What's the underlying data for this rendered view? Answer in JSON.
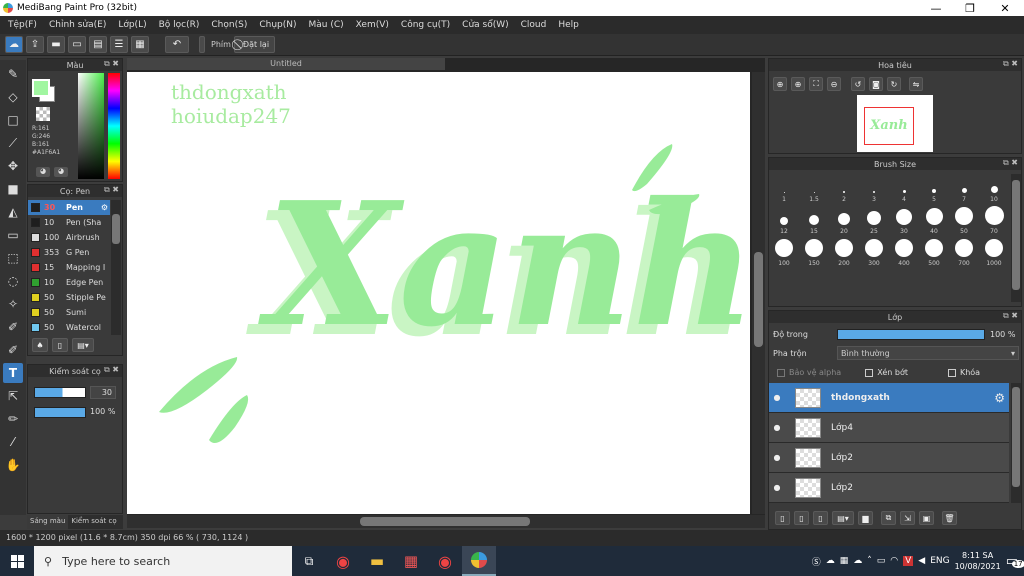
{
  "window": {
    "title": "MediBang Paint Pro (32bit)",
    "minimize": "—",
    "maximize": "❐",
    "close": "✕"
  },
  "menu": [
    "Tệp(F)",
    "Chỉnh sửa(E)",
    "Lớp(L)",
    "Bộ lọc(R)",
    "Chọn(S)",
    "Chụp(N)",
    "Màu (C)",
    "Xem(V)",
    "Công cụ(T)",
    "Cửa sổ(W)",
    "Cloud",
    "Help"
  ],
  "toolbar": {
    "snap_label": "Phím",
    "reset_label": "Đặt lại"
  },
  "color_panel": {
    "title": "Màu",
    "r": "R:161",
    "g": "G:246",
    "b": "B:161",
    "hex": "#A1F6A1",
    "fg": "#A1F6A1"
  },
  "brush_panel": {
    "title": "Cọ: Pen",
    "items": [
      {
        "size": "30",
        "name": "Pen",
        "color": "#1e1e1e"
      },
      {
        "size": "10",
        "name": "Pen (Sha",
        "color": "#1e1e1e"
      },
      {
        "size": "100",
        "name": "Airbrush",
        "color": "#dddddd"
      },
      {
        "size": "353",
        "name": "G Pen",
        "color": "#e03030"
      },
      {
        "size": "15",
        "name": "Mapping I",
        "color": "#e03030"
      },
      {
        "size": "10",
        "name": "Edge Pen",
        "color": "#30a030"
      },
      {
        "size": "50",
        "name": "Stipple Pe",
        "color": "#e0d020"
      },
      {
        "size": "50",
        "name": "Sumi",
        "color": "#e0d020"
      },
      {
        "size": "50",
        "name": "Watercol",
        "color": "#70c8f0"
      }
    ]
  },
  "brush_control": {
    "title": "Kiểm soát cọ",
    "size": "30",
    "opacity": "100 %"
  },
  "left_tabs": {
    "tab1": "Sáng màu",
    "tab2": "Kiểm soát cọ"
  },
  "canvas": {
    "tab": "Untitled",
    "watermark1": "thdongxath",
    "watermark2": "hoiudap247",
    "art_text": "Xanh"
  },
  "navigator": {
    "title": "Hoa tiêu"
  },
  "brush_size": {
    "title": "Brush Size",
    "row1": [
      "1",
      "1.5",
      "2",
      "3",
      "4",
      "5",
      "7",
      "10"
    ],
    "row2": [
      "12",
      "15",
      "20",
      "25",
      "30",
      "40",
      "50",
      "70"
    ],
    "row3": [
      "100",
      "150",
      "200",
      "300",
      "400",
      "500",
      "700",
      "1000"
    ]
  },
  "layer_panel": {
    "title": "Lớp",
    "opacity_label": "Độ trong",
    "opacity_value": "100 %",
    "opacity": 1.0,
    "blend_label": "Pha trộn",
    "blend_value": "Bình thường",
    "alpha_label": "Bảo vệ alpha",
    "clip_label": "Xén bớt",
    "lock_label": "Khóa",
    "layers": [
      "thdongxath",
      "Lớp4",
      "Lớp2",
      "Lớp2"
    ]
  },
  "status": {
    "text": "1600 * 1200 pixel   (11.6 * 8.7cm)   350 dpi   66 %   ( 730, 1124 )"
  },
  "taskbar": {
    "search_placeholder": "Type here to search",
    "lang": "ENG",
    "time": "8:11 SA",
    "date": "10/08/2021",
    "notif_count": "17"
  }
}
